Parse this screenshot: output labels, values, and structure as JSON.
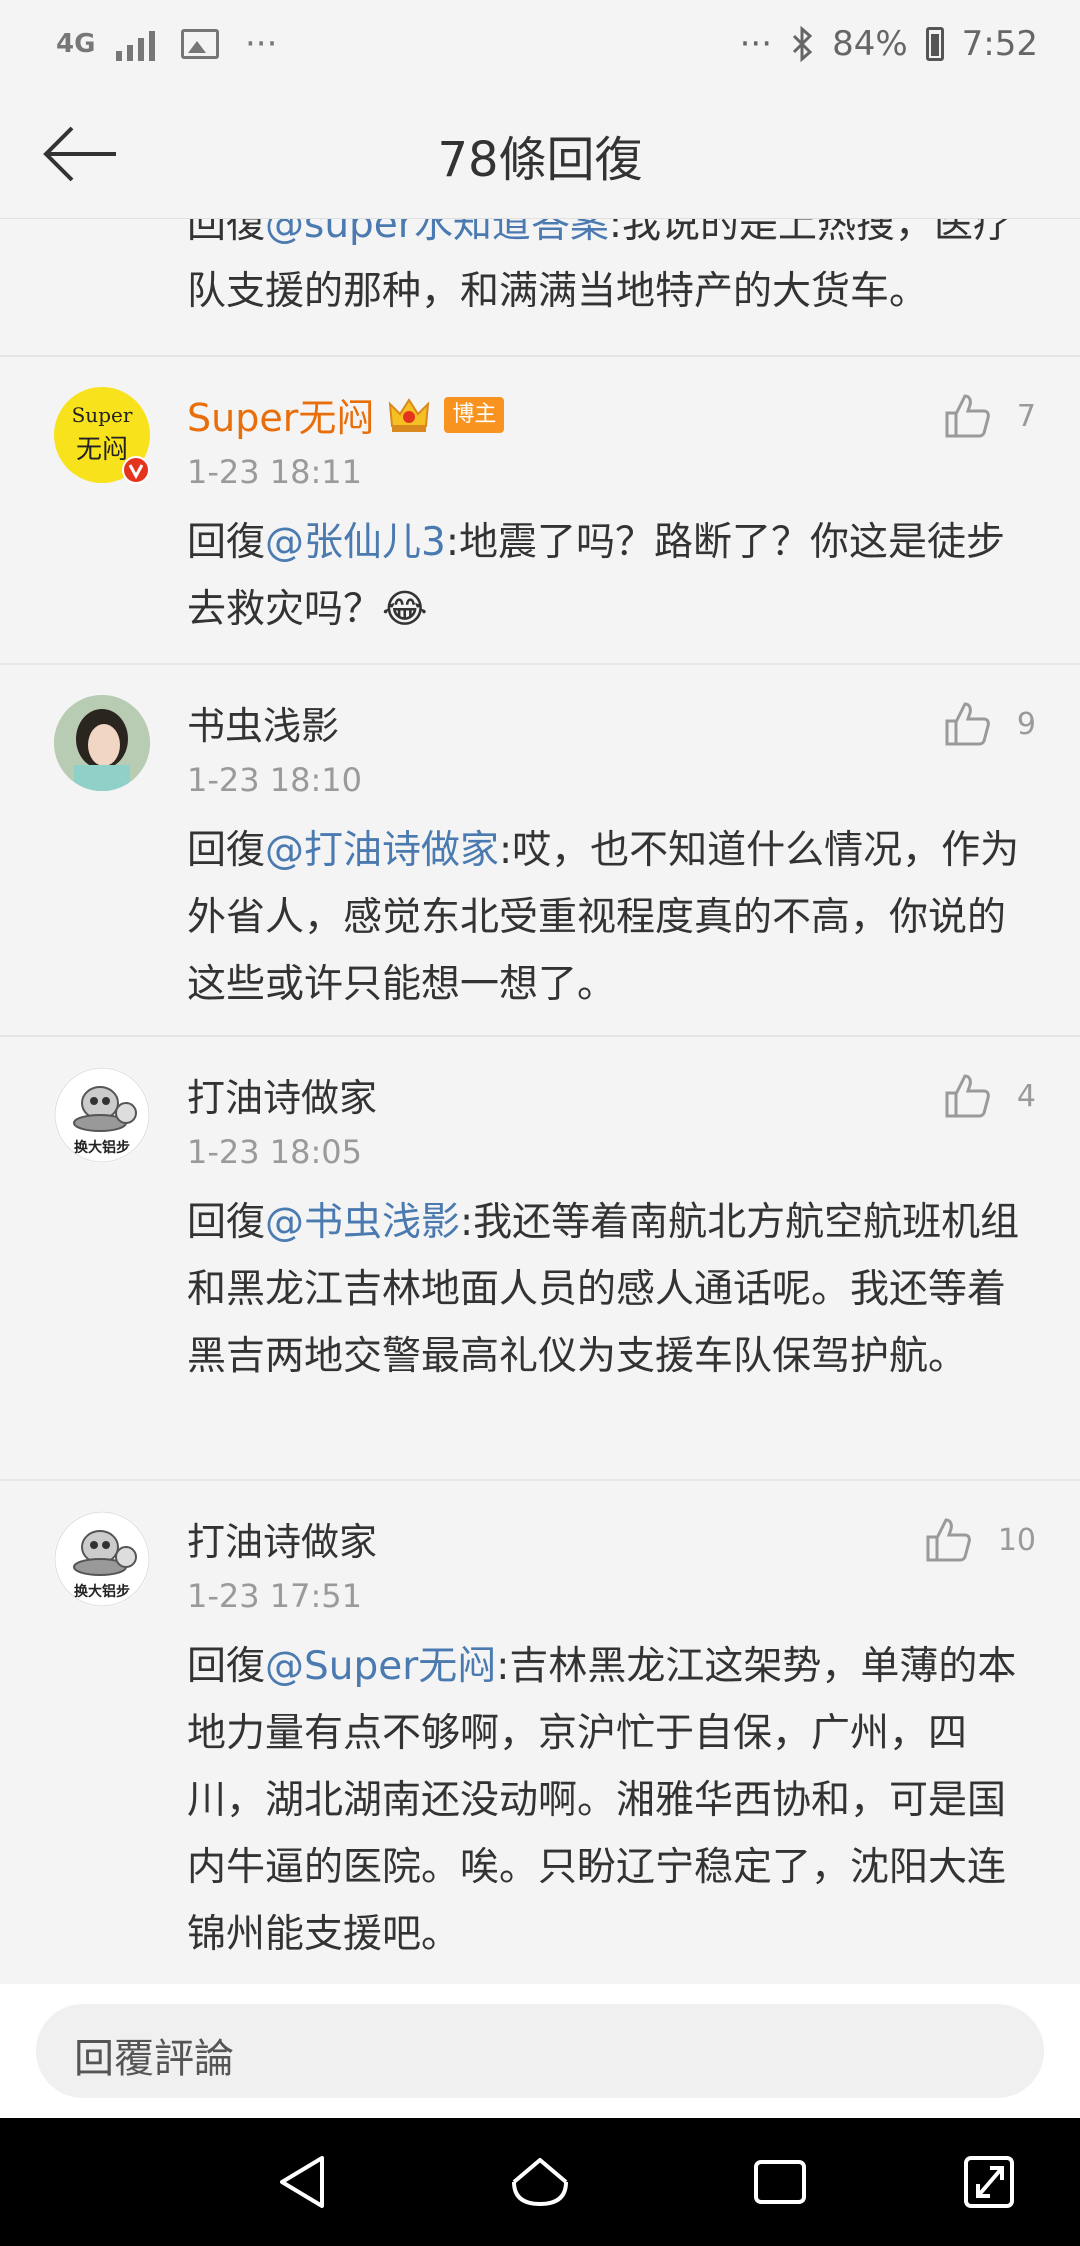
{
  "status_bar": {
    "network": "4G",
    "left_more": "···",
    "right_more": "···",
    "battery": "84%",
    "time": "7:52"
  },
  "header": {
    "title": "78條回復"
  },
  "partial_comment": {
    "prefix": "回復",
    "mention": "@super水知道答案",
    "text": ":我说的是上热搜，医疗队支援的那种，和满满当地特产的大货车。"
  },
  "comments": [
    {
      "author": "Super无闷",
      "badge": "博主",
      "time": "1-23 18:11",
      "likes": "7",
      "prefix": "回復",
      "mention": "@张仙儿3",
      "text": ":地震了吗？路断了？你这是徒步去救灾吗？😂"
    },
    {
      "author": "书虫浅影",
      "time": "1-23 18:10",
      "likes": "9",
      "prefix": "回復",
      "mention": "@打油诗做家",
      "text": ":哎，也不知道什么情况，作为外省人，感觉东北受重视程度真的不高，你说的这些或许只能想一想了。"
    },
    {
      "author": "打油诗做家",
      "time": "1-23 18:05",
      "likes": "4",
      "prefix": "回復",
      "mention": "@书虫浅影",
      "text": ":我还等着南航北方航空航班机组和黑龙江吉林地面人员的感人通话呢。我还等着黑吉两地交警最高礼仪为支援车队保驾护航。"
    },
    {
      "author": "打油诗做家",
      "time": "1-23 17:51",
      "likes": "10",
      "prefix": "回復",
      "mention": "@Super无闷",
      "text": ":吉林黑龙江这架势，单薄的本地力量有点不够啊，京沪忙于自保，广州，四川，湖北湖南还没动啊。湘雅华西协和，可是国内牛逼的医院。唉。只盼辽宁稳定了，沈阳大连锦州能支援吧。"
    }
  ],
  "avatars": {
    "super_line1": "Super",
    "super_line2": "无闷",
    "dayou_caption": "换大铝步"
  },
  "reply_bar": {
    "placeholder": "回覆評論"
  },
  "icons": {
    "back": "back-arrow-icon",
    "like": "thumbs-up-icon",
    "verified": "verified-v-icon",
    "crown": "crown-icon",
    "nav_back": "nav-back-icon",
    "nav_home": "nav-home-icon",
    "nav_recent": "nav-recents-icon",
    "nav_expand": "nav-expand-icon"
  },
  "colors": {
    "mention": "#4a7ab0",
    "vip_name": "#e86e0b",
    "badge": "#f7931e",
    "time": "#9a9a9a"
  }
}
